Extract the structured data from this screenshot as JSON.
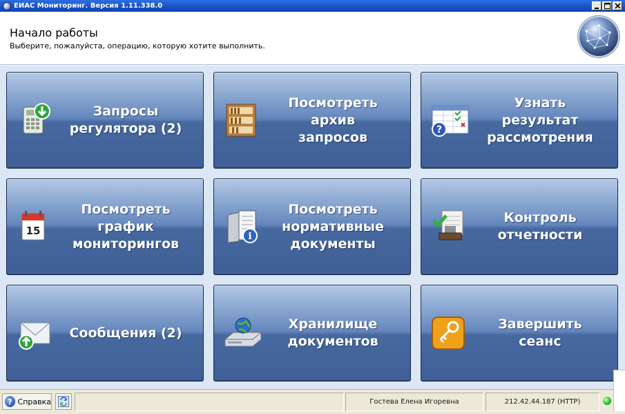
{
  "window": {
    "title": "ЕИАС Мониторинг. Версия 1.11.338.0"
  },
  "header": {
    "title": "Начало работы",
    "subtitle": "Выберите, пожалуйста, операцию, которую хотите выполнить."
  },
  "tiles": [
    {
      "label": "Запросы\nрегулятора (2)",
      "icon": "calculator-download-icon"
    },
    {
      "label": "Посмотреть\nархив\nзапросов",
      "icon": "bookshelf-icon"
    },
    {
      "label": "Узнать\nрезультат\nрассмотрения",
      "icon": "checklist-help-icon"
    },
    {
      "label": "Посмотреть\nграфик\nмониторингов",
      "icon": "calendar-icon"
    },
    {
      "label": "Посмотреть\nнормативные\nдокументы",
      "icon": "document-info-icon"
    },
    {
      "label": "Контроль\nотчетности",
      "icon": "stamp-check-icon"
    },
    {
      "label": "Сообщения (2)",
      "icon": "envelope-upload-icon"
    },
    {
      "label": "Хранилище\nдокументов",
      "icon": "globe-drive-icon"
    },
    {
      "label": "Завершить\nсеанс",
      "icon": "key-icon"
    }
  ],
  "statusbar": {
    "help_label": "Справка",
    "user": "Гостева Елена Игоревна",
    "connection": "212.42.44.187 (HTTP)"
  },
  "colors": {
    "tile_top": "#b4c8e6",
    "tile_bottom": "#3f5f96",
    "titlebar": "#1a55c8",
    "content_bg": "#dbe7f5",
    "status_ok": "#2fbf2f"
  }
}
